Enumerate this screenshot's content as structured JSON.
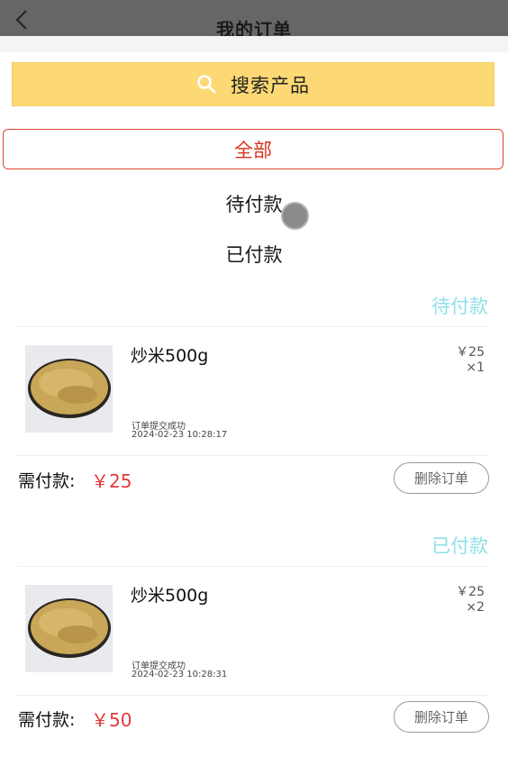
{
  "header": {
    "title": "我的订单"
  },
  "search": {
    "label": "搜索产品"
  },
  "filters": {
    "all": "全部",
    "pending": "待付款",
    "paid": "已付款"
  },
  "colors": {
    "accent": "#e4393c",
    "search_bg": "#fcd974",
    "status": "#8fdfeb"
  },
  "orders": [
    {
      "status": "待付款",
      "product": {
        "name": "炒米500g",
        "price": "￥25",
        "qty": "×1"
      },
      "state_text": "订单提交成功",
      "time": "2024-02-23 10:28:17",
      "need_label": "需付款:",
      "need_amount": "￥25",
      "delete_label": "删除订单"
    },
    {
      "status": "已付款",
      "product": {
        "name": "炒米500g",
        "price": "￥25",
        "qty": "×2"
      },
      "state_text": "订单提交成功",
      "time": "2024-02-23 10:28:31",
      "need_label": "需付款:",
      "need_amount": "￥50",
      "delete_label": "删除订单"
    }
  ]
}
